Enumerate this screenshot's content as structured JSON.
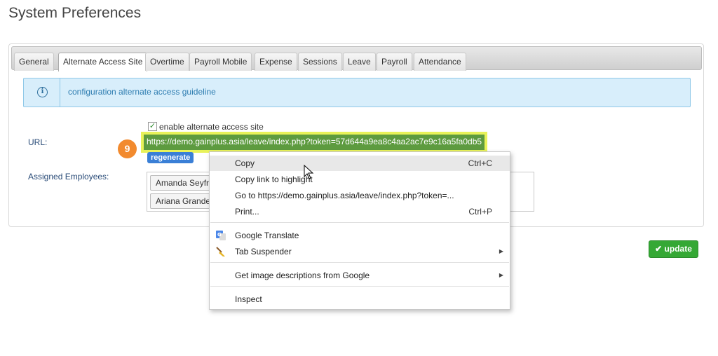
{
  "page": {
    "title": "System Preferences"
  },
  "tabs": [
    {
      "label": "General"
    },
    {
      "label": "Alternate Access Site"
    },
    {
      "label": "Overtime"
    },
    {
      "label": "Payroll Mobile"
    },
    {
      "label": "Expense"
    },
    {
      "label": "Sessions"
    },
    {
      "label": "Leave"
    },
    {
      "label": "Payroll"
    },
    {
      "label": "Attendance"
    }
  ],
  "active_tab": "Alternate Access Site",
  "info": {
    "text": "configuration alternate access guideline",
    "icon": "info-circle-icon"
  },
  "form": {
    "enable_label": "enable alternate access site",
    "enable_checked": true,
    "url_label": "URL:",
    "url_value": "https://demo.gainplus.asia/leave/index.php?token=57d644a9ea8c4aa2ac7e9c16a5fa0db5",
    "regenerate_label": "regenerate",
    "employees_label": "Assigned Employees:",
    "employees": [
      "Amanda Seyfr",
      "Ariana Grande"
    ],
    "step_badge": "9"
  },
  "update_label": "update",
  "context_menu": {
    "items": [
      {
        "label": "Copy",
        "shortcut": "Ctrl+C"
      },
      {
        "label": "Copy link to highlight"
      },
      {
        "label": "Go to https://demo.gainplus.asia/leave/index.php?token=..."
      },
      {
        "label": "Print...",
        "shortcut": "Ctrl+P"
      },
      {
        "label": "Google Translate",
        "icon": "google-translate-icon"
      },
      {
        "label": "Tab Suspender",
        "icon": "broom-icon",
        "submenu": true
      },
      {
        "label": "Get image descriptions from Google",
        "submenu": true
      },
      {
        "label": "Inspect"
      }
    ]
  },
  "colors": {
    "url_highlight": "#e8f25a",
    "url_background": "#5d9b3f",
    "step_badge": "#f28a2e",
    "update_button": "#35a835",
    "regenerate_button": "#3a7fd6",
    "info_background": "#d8eefb"
  }
}
